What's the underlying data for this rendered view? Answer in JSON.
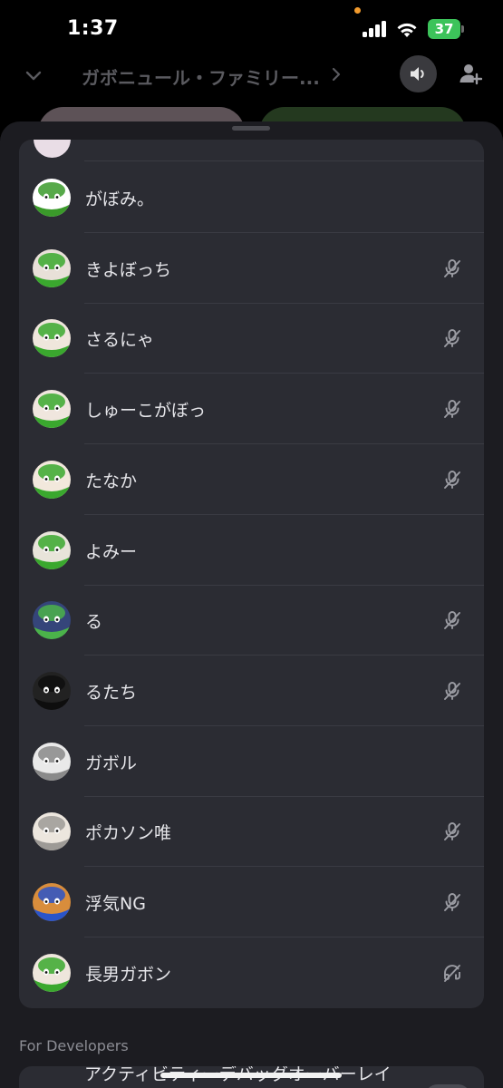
{
  "status_bar": {
    "time": "1:37",
    "battery": "37"
  },
  "header": {
    "channel_title": "ガボニュール・ファミリー..."
  },
  "members": [
    {
      "name": "がぼみ。",
      "muted": false,
      "icon": "",
      "bg": "#ffffff",
      "fg": "#3a9a2a"
    },
    {
      "name": "きよぼっち",
      "muted": true,
      "icon": "mic-off-icon",
      "bg": "#e8e0d8",
      "fg": "#3aa82e"
    },
    {
      "name": "さるにゃ",
      "muted": true,
      "icon": "mic-off-icon",
      "bg": "#efe6dc",
      "fg": "#3aa82e"
    },
    {
      "name": "しゅーこがぼっ",
      "muted": true,
      "icon": "mic-off-icon",
      "bg": "#f0e6de",
      "fg": "#3aa82e"
    },
    {
      "name": "たなか",
      "muted": true,
      "icon": "mic-off-icon",
      "bg": "#f2e8dc",
      "fg": "#3aa82e"
    },
    {
      "name": "よみー",
      "muted": false,
      "icon": "",
      "bg": "#e8e4da",
      "fg": "#3aa82e"
    },
    {
      "name": "る",
      "muted": true,
      "icon": "mic-off-icon",
      "bg": "#35457a",
      "fg": "#4bb34a"
    },
    {
      "name": "るたち",
      "muted": true,
      "icon": "mic-off-icon",
      "bg": "#222222",
      "fg": "#0e0e0e"
    },
    {
      "name": "ガボル",
      "muted": false,
      "icon": "",
      "bg": "#e9e9e9",
      "fg": "#8a8a8a"
    },
    {
      "name": "ポカソン唯",
      "muted": true,
      "icon": "mic-off-icon",
      "bg": "#ece6de",
      "fg": "#9d9a96"
    },
    {
      "name": "浮気NG",
      "muted": true,
      "icon": "mic-off-icon",
      "bg": "#d88d3c",
      "fg": "#2a54c9"
    },
    {
      "name": "長男ガボン",
      "muted": true,
      "icon": "deafened-icon",
      "bg": "#eee6dc",
      "fg": "#3aa82e"
    }
  ],
  "sections": {
    "developers_label": "For Developers"
  },
  "colors": {
    "sheet_bg": "#1c1c21",
    "card_bg": "#2b2c33",
    "separator": "#3a3b43",
    "muted_icon": "#9a9ba2"
  }
}
